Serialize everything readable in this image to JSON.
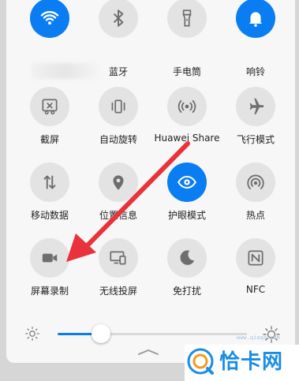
{
  "quick_settings": {
    "row1": [
      {
        "label": "",
        "active": true,
        "icon": "wifi-icon"
      },
      {
        "label": "蓝牙",
        "active": false,
        "icon": "bluetooth-icon"
      },
      {
        "label": "手电筒",
        "active": false,
        "icon": "flashlight-icon"
      },
      {
        "label": "响铃",
        "active": true,
        "icon": "bell-icon"
      }
    ],
    "row2": [
      {
        "label": "截屏",
        "active": false,
        "icon": "screenshot-icon"
      },
      {
        "label": "自动旋转",
        "active": false,
        "icon": "auto-rotate-icon"
      },
      {
        "label": "Huawei Share",
        "active": false,
        "icon": "huawei-share-icon"
      },
      {
        "label": "飞行模式",
        "active": false,
        "icon": "airplane-icon"
      }
    ],
    "row3": [
      {
        "label": "移动数据",
        "active": false,
        "icon": "mobile-data-icon"
      },
      {
        "label": "位置信息",
        "active": false,
        "icon": "location-icon"
      },
      {
        "label": "护眼模式",
        "active": true,
        "icon": "eye-comfort-icon"
      },
      {
        "label": "热点",
        "active": false,
        "icon": "hotspot-icon"
      }
    ],
    "row4": [
      {
        "label": "屏幕录制",
        "active": false,
        "icon": "screen-record-icon"
      },
      {
        "label": "无线投屏",
        "active": false,
        "icon": "wireless-projection-icon"
      },
      {
        "label": "免打扰",
        "active": false,
        "icon": "do-not-disturb-icon"
      },
      {
        "label": "NFC",
        "active": false,
        "icon": "nfc-icon"
      }
    ]
  },
  "brightness": {
    "level": 0.23,
    "icon_low": "sun-small-icon",
    "icon_high": "sun-big-icon"
  },
  "watermark": {
    "text": "恰卡网",
    "url": "www.qiaqa.com"
  },
  "colors": {
    "accent": "#0a7df2",
    "arrow": "#e8323c",
    "watermark": "#1a8de6"
  }
}
